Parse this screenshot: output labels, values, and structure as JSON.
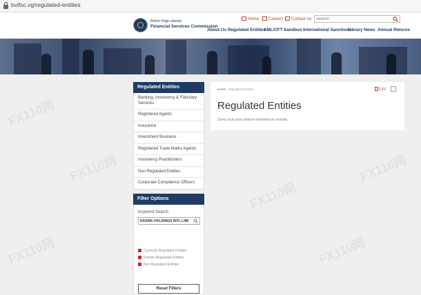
{
  "browser": {
    "url": "bvifsc.vg/regulated-entities"
  },
  "header": {
    "logo_sub": "British Virgin Islands",
    "logo_title": "Financial Services Commission",
    "util_links": {
      "home": "Home",
      "careers": "Careers",
      "contact": "Contact Us"
    },
    "search_placeholder": "Search",
    "nav": [
      "About Us",
      "Regulated Entities",
      "AML/CFT",
      "Sandbox",
      "International Sanctions",
      "Library",
      "News",
      "Annual Returns"
    ]
  },
  "sidebar": {
    "title": "Regulated Entities",
    "items": [
      "Banking, Insolvency & Fiduciary Services",
      "Registered Agents",
      "Insurance",
      "Investment Business",
      "Registered Trade Marks Agents",
      "Insolvency Practitioners",
      "Non Regulated Entities",
      "Corporate Compliance Officers"
    ]
  },
  "filter": {
    "title": "Filter Options",
    "keyword_label": "Keyword Search",
    "keyword_value": "KIGIWK HOLDINGS INTL LIMI",
    "checkboxes": [
      "Currently Regulated Entities",
      "Former Regulated Entities",
      "Non Regulated Entities"
    ],
    "reset_label": "Reset Filters"
  },
  "main": {
    "breadcrumb_home": "Home",
    "breadcrumb_sep": "›",
    "breadcrumb_current": "Regulated Entities",
    "title": "Regulated Entities",
    "message": "Sorry, but your search returned no results.",
    "csv_label": "CSV"
  },
  "watermark": "FX110网",
  "colors": {
    "navy": "#1d3b63",
    "accent_red": "#c0392b",
    "page_bg": "#efefef"
  }
}
